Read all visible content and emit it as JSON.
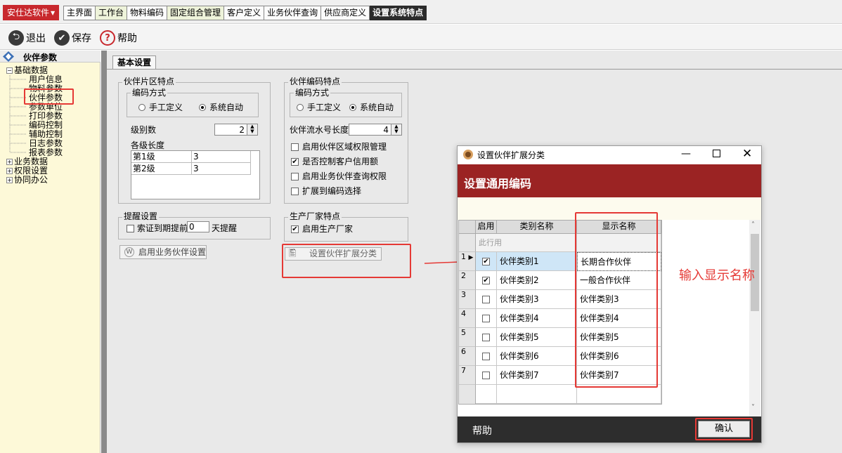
{
  "top_bar": {
    "brand": "安仕达软件",
    "tabs": [
      {
        "label": "主界面"
      },
      {
        "label": "工作台"
      },
      {
        "label": "物料编码"
      },
      {
        "label": "固定组合管理"
      },
      {
        "label": "客户定义"
      },
      {
        "label": "业务伙伴查询"
      },
      {
        "label": "供应商定义"
      },
      {
        "label": "设置系统特点"
      }
    ],
    "active_tab": "设置系统特点"
  },
  "toolbar": {
    "exit_label": "退出",
    "save_label": "保存",
    "help_label": "帮助",
    "help_glyph": "?"
  },
  "left_panel": {
    "title": "伙伴参数",
    "tree": {
      "basic": "基础数据",
      "items": [
        "用户信息",
        "物料参数",
        "伙伴参数",
        "参数单位",
        "打印参数",
        "编码控制",
        "辅助控制",
        "日志参数",
        "报表参数"
      ],
      "selected": "伙伴参数",
      "others": [
        "业务数据",
        "权限设置",
        "协同办公"
      ]
    }
  },
  "main": {
    "tab": "基本设置",
    "partner_region": {
      "title": "伙伴片区特点",
      "coding_title": "编码方式",
      "manual": "手工定义",
      "auto": "系统自动",
      "selected": "auto",
      "levels_label": "级别数",
      "levels_value": "2",
      "level_length_label": "各级长度",
      "level_rows": [
        {
          "level": "第1级",
          "length": "3"
        },
        {
          "level": "第2级",
          "length": "3"
        }
      ]
    },
    "reminder": {
      "title": "提醒设置",
      "check_label": "索证到期提前",
      "days_value": "0",
      "days_suffix": "天提醒",
      "checked": false
    },
    "enable_partner_setting_button": "启用业务伙伴设置",
    "partner_code": {
      "title": "伙伴编码特点",
      "coding_title": "编码方式",
      "manual": "手工定义",
      "auto": "系统自动",
      "selected": "auto",
      "serial_label": "伙伴流水号长度",
      "serial_value": "4",
      "options": [
        {
          "label": "启用伙伴区域权限管理",
          "checked": false
        },
        {
          "label": "是否控制客户信用额",
          "checked": true
        },
        {
          "label": "启用业务伙伴查询权限",
          "checked": false
        },
        {
          "label": "扩展到编码选择",
          "checked": false
        }
      ]
    },
    "manufacturer": {
      "title": "生产厂家特点",
      "enable_label": "启用生产厂家",
      "checked": true
    },
    "extension_button": "设置伙伴扩展分类"
  },
  "dialog": {
    "title": "设置伙伴扩展分类",
    "banner": "设置通用编码",
    "columns": [
      "启用",
      "类别名称",
      "显示名称"
    ],
    "placeholder_row": "此行用",
    "rows": [
      {
        "num": "1",
        "enabled": true,
        "category": "伙伴类别1",
        "display": "长期合作伙伴"
      },
      {
        "num": "2",
        "enabled": true,
        "category": "伙伴类别2",
        "display": "一般合作伙伴"
      },
      {
        "num": "3",
        "enabled": false,
        "category": "伙伴类别3",
        "display": "伙伴类别3"
      },
      {
        "num": "4",
        "enabled": false,
        "category": "伙伴类别4",
        "display": "伙伴类别4"
      },
      {
        "num": "5",
        "enabled": false,
        "category": "伙伴类别5",
        "display": "伙伴类别5"
      },
      {
        "num": "6",
        "enabled": false,
        "category": "伙伴类别6",
        "display": "伙伴类别6"
      },
      {
        "num": "7",
        "enabled": false,
        "category": "伙伴类别7",
        "display": "伙伴类别7"
      }
    ],
    "help": "帮助",
    "confirm": "确认"
  },
  "annotation": "输入显示名称",
  "colors": {
    "brand_red": "#c8282d",
    "banner_red": "#9b2323",
    "highlight_red": "#e53935",
    "tree_bg": "#fdf9d8"
  }
}
